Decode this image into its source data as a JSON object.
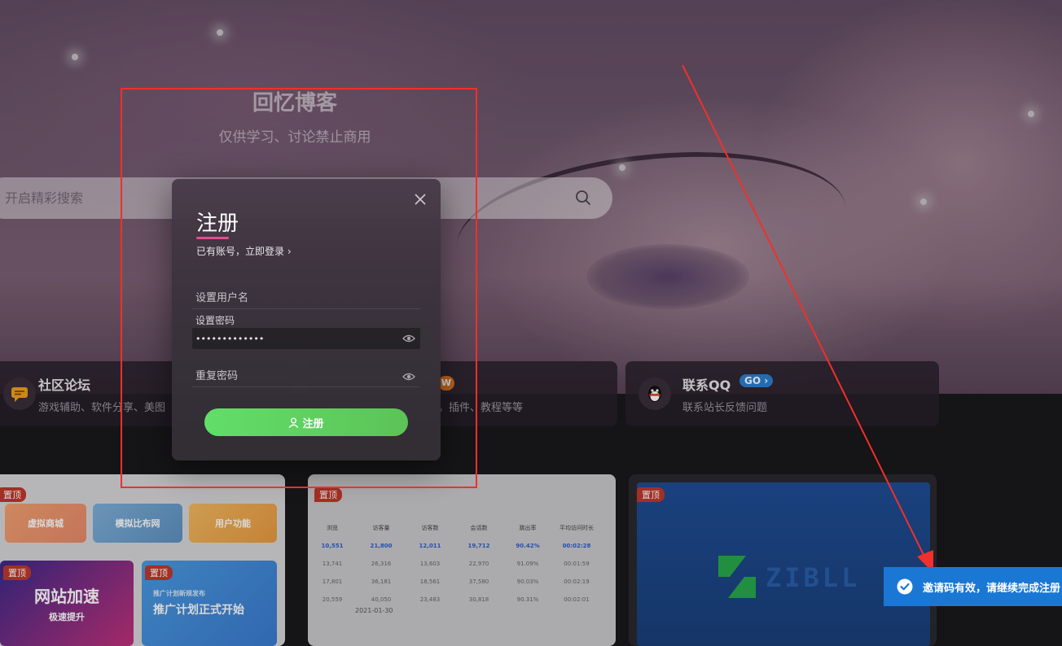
{
  "site": {
    "title": "回忆博客",
    "subtitle": "仅供学习、讨论禁止商用"
  },
  "search": {
    "placeholder": "开启精彩搜索"
  },
  "features": [
    {
      "title": "社区论坛",
      "description": "游戏辅助、软件分享、美图",
      "icon": "chat-icon"
    },
    {
      "badge": "W",
      "description": "。插件、教程等等"
    },
    {
      "title": "联系QQ",
      "badge": "GO",
      "description": "联系站长反馈问题",
      "icon": "qq-penguin-icon"
    }
  ],
  "posts": [
    {
      "pin": "置顶",
      "tiles": [
        "虚拟商城",
        "模拟比布网",
        "用户功能"
      ],
      "sub_pin": "置顶",
      "banner1": "网站加速",
      "banner1_sub": "极速提升",
      "sub_pin2": "置顶",
      "banner2_small": "推广计划新规发布",
      "banner2": "推广计划正式开始"
    },
    {
      "pin": "置顶",
      "headers": [
        "浏览",
        "访客量",
        "访客数",
        "会话数",
        "跳出率",
        "平均访问时长"
      ],
      "rows": [
        [
          "10,551",
          "21,800",
          "12,011",
          "19,712",
          "90.42%",
          "00:02:28"
        ],
        [
          "13,741",
          "26,316",
          "13,603",
          "22,970",
          "91.09%",
          "00:01:59"
        ],
        [
          "17,801",
          "36,181",
          "18,561",
          "37,580",
          "90.03%",
          "00:02:19"
        ],
        [
          "20,559",
          "40,050",
          "23,483",
          "30,818",
          "90.31%",
          "00:02:01"
        ]
      ],
      "date": "2021-01-30"
    },
    {
      "pin": "置顶",
      "logo_text": "ZIBLL"
    }
  ],
  "modal": {
    "title": "注册",
    "login_link": "已有账号，立即登录 ›",
    "username_placeholder": "设置用户名",
    "password_label": "设置密码",
    "password_value": "•••••••••••••",
    "repeat_placeholder": "重复密码",
    "submit_label": "注册"
  },
  "toast": {
    "message": "邀请码有效，请继续完成注册"
  },
  "colors": {
    "accent_green": "#5cd462",
    "toast_blue": "#1a78d4",
    "annotation_red": "#f0302a",
    "underline_pink": "#e34d8f"
  }
}
